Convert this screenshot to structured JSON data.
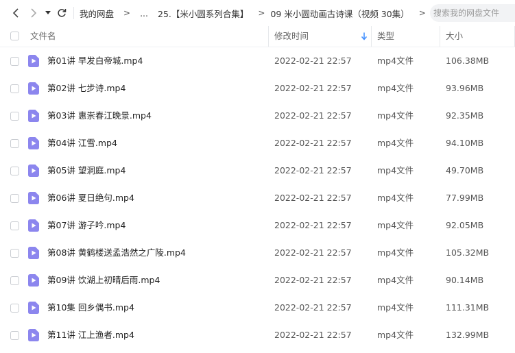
{
  "toolbar": {
    "breadcrumbs": [
      "我的网盘",
      "...",
      "25.【米小圆系列合集】",
      "09 米小圆动画古诗课（视频 30集）"
    ],
    "search_placeholder": "搜索我的网盘文件"
  },
  "header": {
    "name": "文件名",
    "time": "修改时间",
    "type": "类型",
    "size": "大小"
  },
  "files": [
    {
      "name": "第01讲 早发白帝城.mp4",
      "time": "2022-02-21 22:57",
      "type": "mp4文件",
      "size": "106.38MB"
    },
    {
      "name": "第02讲 七步诗.mp4",
      "time": "2022-02-21 22:57",
      "type": "mp4文件",
      "size": "93.96MB"
    },
    {
      "name": "第03讲 惠崇春江晚景.mp4",
      "time": "2022-02-21 22:57",
      "type": "mp4文件",
      "size": "92.35MB"
    },
    {
      "name": "第04讲 江雪.mp4",
      "time": "2022-02-21 22:57",
      "type": "mp4文件",
      "size": "94.10MB"
    },
    {
      "name": "第05讲 望洞庭.mp4",
      "time": "2022-02-21 22:57",
      "type": "mp4文件",
      "size": "49.70MB"
    },
    {
      "name": "第06讲 夏日绝句.mp4",
      "time": "2022-02-21 22:57",
      "type": "mp4文件",
      "size": "77.99MB"
    },
    {
      "name": "第07讲 游子吟.mp4",
      "time": "2022-02-21 22:57",
      "type": "mp4文件",
      "size": "92.05MB"
    },
    {
      "name": "第08讲 黄鹤楼送孟浩然之广陵.mp4",
      "time": "2022-02-21 22:57",
      "type": "mp4文件",
      "size": "105.32MB"
    },
    {
      "name": "第09讲 饮湖上初晴后雨.mp4",
      "time": "2022-02-21 22:57",
      "type": "mp4文件",
      "size": "90.14MB"
    },
    {
      "name": "第10集 回乡偶书.mp4",
      "time": "2022-02-21 22:57",
      "type": "mp4文件",
      "size": "111.31MB"
    },
    {
      "name": "第11讲 江上渔者.mp4",
      "time": "2022-02-21 22:57",
      "type": "mp4文件",
      "size": "132.99MB"
    }
  ],
  "colors": {
    "icon_purple": "#8c86ee",
    "sort_arrow": "#3b8cff"
  },
  "icons": {
    "back": "chevron-left-icon",
    "forward": "chevron-right-icon",
    "dropdown": "caret-down-icon",
    "refresh": "refresh-icon",
    "sort": "sort-desc-icon",
    "file": "video-file-icon"
  }
}
